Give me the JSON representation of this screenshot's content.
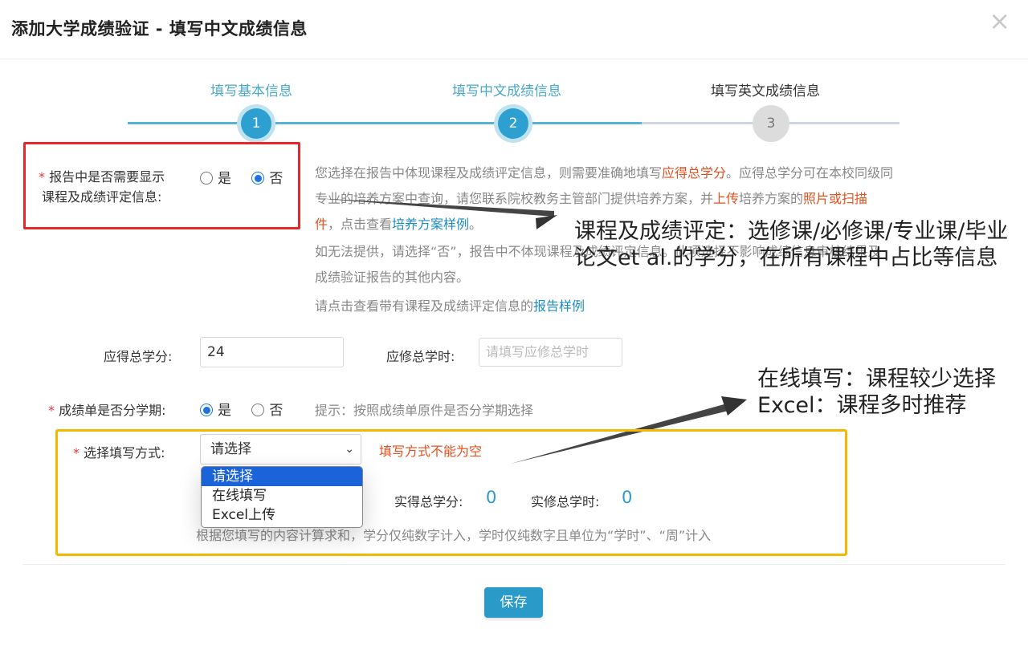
{
  "dialog": {
    "title": "添加大学成绩验证 - 填写中文成绩信息",
    "close_glyph": "×"
  },
  "steps": [
    {
      "label": "填写基本信息",
      "number": "1",
      "state": "done"
    },
    {
      "label": "填写中文成绩信息",
      "number": "2",
      "state": "current"
    },
    {
      "label": "填写英文成绩信息",
      "number": "3",
      "state": "todo"
    }
  ],
  "show_course_info": {
    "required_mark": "*",
    "label_line1": "报告中是否需要显示",
    "label_line2": "课程及成绩评定信息:",
    "options": [
      "是",
      "否"
    ],
    "selected": "否"
  },
  "info": {
    "p1_a": "您选择在报告中体现课程及成绩评定信息，则需要准确地填写",
    "p1_b": "应得总学分",
    "p1_c": "。应得总学分可在本校同级同",
    "p1_d": "专业的培养方案中查询，请您联系院校教务主管部门提供培养方案，并",
    "p1_e": "上传",
    "p1_f": "培养方案的",
    "p1_g": "照片或扫描",
    "p1_h": "件",
    "p1_i": "，点击查看",
    "p1_j": "培养方案样例",
    "p1_k": "。",
    "p2_a": "如无法提供，请选择“否”，报告中不体现课程及成绩评定信息。此项选择不影响成绩信息审核结果及",
    "p2_b": "成绩验证报告的其他内容。",
    "p3_a": "请点击查看带有课程及成绩评定信息的",
    "p3_b": "报告样例"
  },
  "annotations": {
    "a1_line1": "课程及成绩评定：选修课/必修课/专业课/毕业",
    "a1_line2": "论文et al.的学分，在所有课程中占比等信息",
    "a2_line1": "在线填写：课程较少选择",
    "a2_line2": "Excel：课程多时推荐"
  },
  "credits": {
    "label": "应得总学分:",
    "value": "24",
    "hours_label": "应修总学时:",
    "hours_placeholder": "请填写应修总学时"
  },
  "semester": {
    "required_mark": "*",
    "label": "成绩单是否分学期:",
    "options": [
      "是",
      "否"
    ],
    "selected": "是",
    "hint": "提示：按照成绩单原件是否分学期选择"
  },
  "fill_method": {
    "required_mark": "*",
    "label": "选择填写方式:",
    "selected": "请选择",
    "error": "填写方式不能为空",
    "options": [
      "请选择",
      "在线填写",
      "Excel上传"
    ]
  },
  "totals": {
    "earned_credits_label": "实得总学分:",
    "earned_credits_value": "0",
    "earned_hours_label": "实修总学时:",
    "earned_hours_value": "0",
    "note": "根据您填写的内容计算求和，学分仅纯数字计入，学时仅纯数字且单位为“学时”、“周”计入"
  },
  "footer": {
    "save_label": "保存"
  },
  "colors": {
    "accent": "#2a9bc9",
    "error": "#e4501e",
    "red_box": "#e8262a",
    "yellow_box": "#f5b800"
  }
}
